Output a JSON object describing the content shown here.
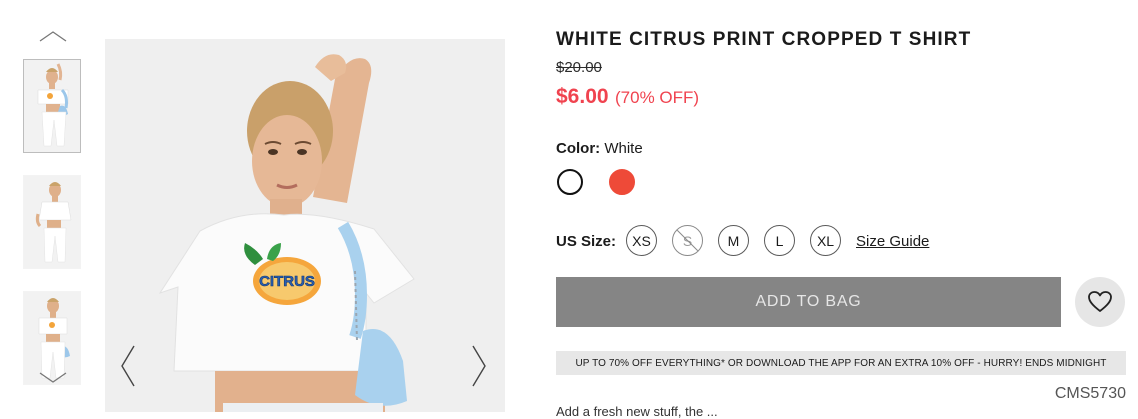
{
  "product": {
    "title": "WHITE CITRUS PRINT CROPPED T SHIRT",
    "original_price": "$20.00",
    "sale_price": "$6.00",
    "discount": "(70% OFF)",
    "product_code": "CMS5730",
    "description_start": "Add a fresh new stuff, the ..."
  },
  "color": {
    "label": "Color:",
    "selected": "White",
    "swatches": [
      {
        "name": "White",
        "hex": "#ffffff"
      },
      {
        "name": "Red",
        "hex": "#ee4a38"
      }
    ]
  },
  "size": {
    "label": "US Size:",
    "options": [
      {
        "label": "XS",
        "available": true
      },
      {
        "label": "S",
        "available": false
      },
      {
        "label": "M",
        "available": true
      },
      {
        "label": "L",
        "available": true
      },
      {
        "label": "XL",
        "available": true
      }
    ],
    "guide_label": "Size Guide"
  },
  "actions": {
    "add_to_bag": "ADD TO BAG",
    "wishlist_icon": "heart-icon"
  },
  "promo_banner": "UP TO 70% OFF EVERYTHING* OR DOWNLOAD THE APP FOR AN EXTRA 10% OFF - HURRY! ENDS MIDNIGHT",
  "gallery": {
    "thumbnail_count": 3,
    "active_index": 0,
    "icons": {
      "up": "chevron-up-icon",
      "down": "chevron-down-icon",
      "prev": "chevron-left-icon",
      "next": "chevron-right-icon"
    },
    "print_text": "CITRUS"
  },
  "colors": {
    "sale": "#f0434f",
    "button_disabled": "#858585",
    "promo_bg": "#e7e7e7"
  }
}
